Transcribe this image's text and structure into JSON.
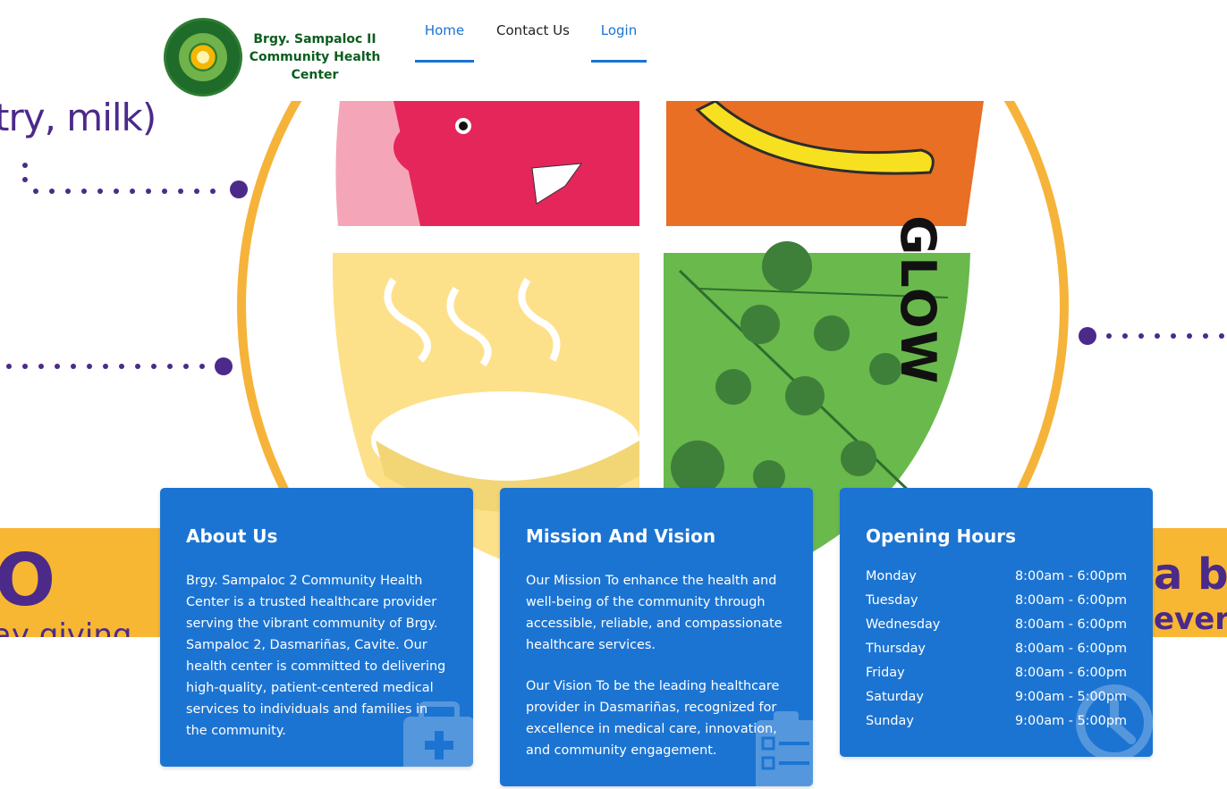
{
  "header": {
    "brand_name": "Brgy. Sampaloc II Community Health Center",
    "brand_line1": "Brgy. Sampaloc II",
    "brand_line2": "Community Health",
    "brand_line3": "Center",
    "nav": {
      "home": "Home",
      "contact": "Contact Us",
      "login": "Login"
    }
  },
  "hero": {
    "side_text_top": "try, milk)",
    "glow_label": "GLOW",
    "bottom_left_text": "O",
    "bottom_left_sub": "ay giving",
    "bottom_right_text": "a ba",
    "bottom_right_sub": "everyd"
  },
  "about": {
    "title": "About Us",
    "text": "Brgy. Sampaloc 2 Community Health Center is a trusted healthcare provider serving the vibrant community of Brgy. Sampaloc 2, Dasmariñas, Cavite. Our health center is committed to delivering high-quality, patient-centered medical services to individuals and families in the community."
  },
  "mission": {
    "title": "Mission And Vision",
    "mission_text": "Our Mission To enhance the health and well-being of the community through accessible, reliable, and compassionate healthcare services.",
    "vision_text": "Our Vision To be the leading healthcare provider in Dasmariñas, recognized for excellence in medical care, innovation, and community engagement."
  },
  "hours": {
    "title": "Opening Hours",
    "rows": [
      {
        "day": "Monday",
        "time": "8:00am - 6:00pm"
      },
      {
        "day": "Tuesday",
        "time": "8:00am - 6:00pm"
      },
      {
        "day": "Wednesday",
        "time": "8:00am - 6:00pm"
      },
      {
        "day": "Thursday",
        "time": "8:00am - 6:00pm"
      },
      {
        "day": "Friday",
        "time": "8:00am - 6:00pm"
      },
      {
        "day": "Saturday",
        "time": "9:00am - 5:00pm"
      },
      {
        "day": "Sunday",
        "time": "9:00am - 5:00pm"
      }
    ]
  },
  "colors": {
    "accent": "#1a73d1",
    "card": "#1c74d2",
    "brand_green": "#0b5d1e"
  }
}
